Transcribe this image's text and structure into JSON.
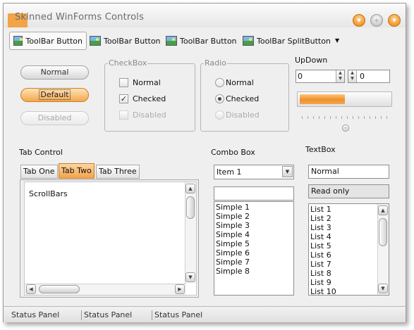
{
  "window": {
    "title": "Skinned WinForms Controls"
  },
  "title_buttons": [
    {
      "name": "minimize",
      "glyph": "▾"
    },
    {
      "name": "maximize",
      "glyph": "+"
    },
    {
      "name": "close",
      "glyph": "▾"
    }
  ],
  "toolbar": {
    "items": [
      {
        "label": "ToolBar Button",
        "pressed": true,
        "icon": "picture-icon"
      },
      {
        "label": "ToolBar Button",
        "pressed": false,
        "icon": "picture-icon"
      },
      {
        "label": "ToolBar Button",
        "pressed": false,
        "icon": "picture-icon"
      },
      {
        "label": "ToolBar SplitButton",
        "pressed": false,
        "icon": "picture-icon"
      }
    ],
    "split_arrow": "▼"
  },
  "buttons": {
    "normal": "Normal",
    "default": "Default",
    "disabled": "Disabled"
  },
  "checkbox_group": {
    "label": "CheckBox",
    "items": [
      {
        "label": "Normal",
        "checked": false,
        "enabled": true
      },
      {
        "label": "Checked",
        "checked": true,
        "enabled": true
      },
      {
        "label": "Disabled",
        "checked": false,
        "enabled": false
      }
    ],
    "check_glyph": "✓"
  },
  "radio_group": {
    "label": "Radio",
    "items": [
      {
        "label": "Normal",
        "selected": false,
        "enabled": true
      },
      {
        "label": "Checked",
        "selected": true,
        "enabled": true
      },
      {
        "label": "Disabled",
        "selected": false,
        "enabled": false
      }
    ]
  },
  "updown": {
    "label": "UpDown",
    "value1": "0",
    "value2": "0"
  },
  "progress": {
    "value": 0.5
  },
  "tab_control": {
    "label": "Tab Control",
    "tabs": [
      "Tab One",
      "Tab Two",
      "Tab Three"
    ],
    "active_index": 1,
    "content": "ScrollBars"
  },
  "combo_box": {
    "label": "Combo Box",
    "selected": "Item 1",
    "simple_value": "",
    "list_items": [
      "Simple 1",
      "Simple 2",
      "Simple 3",
      "Simple 4",
      "Simple 5",
      "Simple 6",
      "Simple 7",
      "Simple 8"
    ]
  },
  "textbox": {
    "label": "TextBox",
    "normal_value": "Normal",
    "readonly_value": "Read only",
    "list_items": [
      "List 1",
      "List 2",
      "List 3",
      "List 4",
      "List 5",
      "List 6",
      "List 7",
      "List 8",
      "List 9",
      "List 10"
    ]
  },
  "status_bar": {
    "panels": [
      "Status Panel",
      "Status Panel",
      "Status Panel"
    ]
  },
  "colors": {
    "accent": "#f0962a",
    "window_bg": "#efefef",
    "border": "#9b9b9b"
  }
}
